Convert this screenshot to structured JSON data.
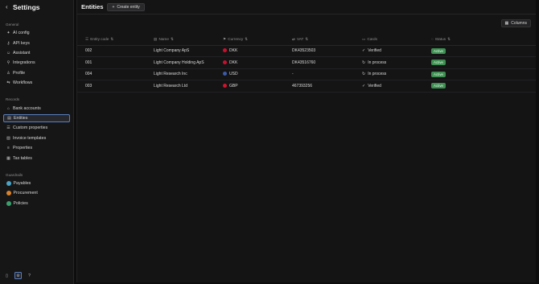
{
  "sidebar": {
    "title": "Settings",
    "sections": {
      "general": "General",
      "records": "Records",
      "guardrails": "Guardrails"
    },
    "general_items": [
      {
        "label": "AI config",
        "icon": "sparkle-icon"
      },
      {
        "label": "API keys",
        "icon": "key-icon"
      },
      {
        "label": "Assistant",
        "icon": "bot-icon"
      },
      {
        "label": "Integrations",
        "icon": "plug-icon"
      },
      {
        "label": "Profile",
        "icon": "user-icon"
      },
      {
        "label": "Workflows",
        "icon": "workflow-icon"
      }
    ],
    "records_items": [
      {
        "label": "Bank accounts",
        "icon": "bank-icon"
      },
      {
        "label": "Entities",
        "icon": "building-icon",
        "active": true
      },
      {
        "label": "Custom properties",
        "icon": "properties-icon"
      },
      {
        "label": "Invoice templates",
        "icon": "template-icon"
      },
      {
        "label": "Properties",
        "icon": "list-icon"
      },
      {
        "label": "Tax tables",
        "icon": "table-icon"
      }
    ],
    "guardrails_items": [
      {
        "label": "Payables",
        "color": "#4aa3c7"
      },
      {
        "label": "Procurement",
        "color": "#d9822b"
      },
      {
        "label": "Policies",
        "color": "#3aa06b"
      }
    ]
  },
  "header": {
    "title": "Entities",
    "create_label": "Create entity",
    "columns_label": "Columns"
  },
  "table": {
    "columns": [
      "Entity code",
      "Name",
      "Currency",
      "VAT",
      "Cards",
      "Status"
    ],
    "rows": [
      {
        "code": "002",
        "name": "Light Company ApS",
        "currency": "DKK",
        "flag": "#c8102e",
        "vat": "DK43523503",
        "cards": "Verified",
        "cards_icon": "check",
        "status": "Active"
      },
      {
        "code": "001",
        "name": "Light Company Holding ApS",
        "currency": "DKK",
        "flag": "#c8102e",
        "vat": "DK43516760",
        "cards": "In process",
        "cards_icon": "refresh",
        "status": "Active"
      },
      {
        "code": "004",
        "name": "Light Research Inc",
        "currency": "USD",
        "flag": "#3c5aa6",
        "vat": "-",
        "cards": "In process",
        "cards_icon": "refresh",
        "status": "Active"
      },
      {
        "code": "003",
        "name": "Light Research Ltd",
        "currency": "GBP",
        "flag": "#cf142b",
        "vat": "467393256",
        "cards": "Verified",
        "cards_icon": "check",
        "status": "Active"
      }
    ]
  },
  "colors": {
    "accent_border": "#5a7fbf",
    "status_active": "#3f8f52"
  }
}
